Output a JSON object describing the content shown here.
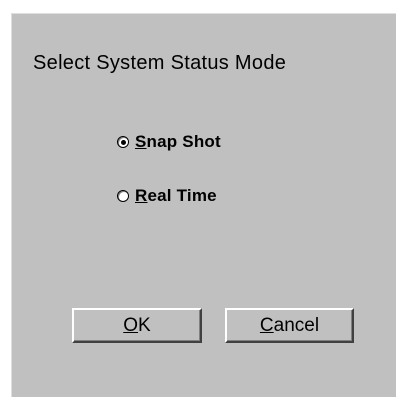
{
  "dialog": {
    "heading": "Select System Status Mode",
    "options": [
      {
        "mnemonic": "S",
        "rest": "nap Shot",
        "selected": true
      },
      {
        "mnemonic": "R",
        "rest": "eal Time",
        "selected": false
      }
    ],
    "buttons": {
      "ok": {
        "mnemonic": "O",
        "rest": "K"
      },
      "cancel": {
        "mnemonic": "C",
        "rest": "ancel"
      }
    }
  }
}
